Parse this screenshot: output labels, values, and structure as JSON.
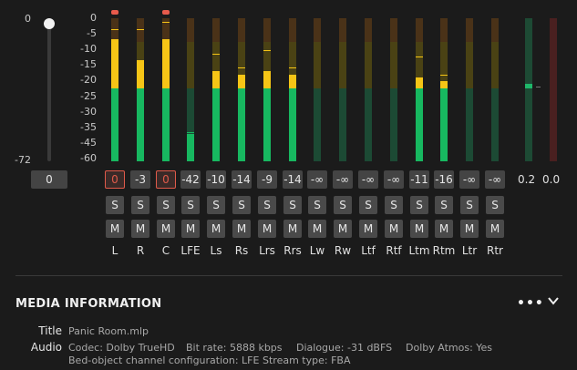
{
  "master_fader": {
    "top_label": "0",
    "bottom_label": "-72",
    "value": "0",
    "level_fraction": 1.0
  },
  "meter_scale": [
    "0",
    "-5",
    "-10",
    "-15",
    "-20",
    "-25",
    "-30",
    "-35",
    "-40",
    "-45",
    "-50",
    "-60"
  ],
  "channels": [
    {
      "name": "L",
      "peak": "0",
      "clip": true,
      "level_db": -6,
      "hold_db": -3,
      "solo": "S",
      "mute": "M"
    },
    {
      "name": "R",
      "peak": "-3",
      "clip": false,
      "level_db": -12,
      "hold_db": -3,
      "solo": "S",
      "mute": "M"
    },
    {
      "name": "C",
      "peak": "0",
      "clip": true,
      "level_db": -6,
      "hold_db": -1,
      "solo": "S",
      "mute": "M"
    },
    {
      "name": "LFE",
      "peak": "-42",
      "clip": false,
      "level_db": -45,
      "hold_db": -44,
      "solo": "S",
      "mute": "M"
    },
    {
      "name": "Ls",
      "peak": "-10",
      "clip": false,
      "level_db": -15,
      "hold_db": -10,
      "solo": "S",
      "mute": "M"
    },
    {
      "name": "Rs",
      "peak": "-14",
      "clip": false,
      "level_db": -16,
      "hold_db": -14,
      "solo": "S",
      "mute": "M"
    },
    {
      "name": "Lrs",
      "peak": "-9",
      "clip": false,
      "level_db": -15,
      "hold_db": -9,
      "solo": "S",
      "mute": "M"
    },
    {
      "name": "Rrs",
      "peak": "-14",
      "clip": false,
      "level_db": -16,
      "hold_db": -14,
      "solo": "S",
      "mute": "M"
    },
    {
      "name": "Lw",
      "peak": "-∞",
      "clip": false,
      "level_db": null,
      "hold_db": null,
      "solo": "S",
      "mute": "M"
    },
    {
      "name": "Rw",
      "peak": "-∞",
      "clip": false,
      "level_db": null,
      "hold_db": null,
      "solo": "S",
      "mute": "M"
    },
    {
      "name": "Ltf",
      "peak": "-∞",
      "clip": false,
      "level_db": null,
      "hold_db": null,
      "solo": "S",
      "mute": "M"
    },
    {
      "name": "Rtf",
      "peak": "-∞",
      "clip": false,
      "level_db": null,
      "hold_db": null,
      "solo": "S",
      "mute": "M"
    },
    {
      "name": "Ltm",
      "peak": "-11",
      "clip": false,
      "level_db": -17,
      "hold_db": -11,
      "solo": "S",
      "mute": "M"
    },
    {
      "name": "Rtm",
      "peak": "-16",
      "clip": false,
      "level_db": -18,
      "hold_db": -16,
      "solo": "S",
      "mute": "M"
    },
    {
      "name": "Ltr",
      "peak": "-∞",
      "clip": false,
      "level_db": null,
      "hold_db": null,
      "solo": "S",
      "mute": "M"
    },
    {
      "name": "Rtr",
      "peak": "-∞",
      "clip": false,
      "level_db": null,
      "hold_db": null,
      "solo": "S",
      "mute": "M"
    }
  ],
  "extra_meters": [
    {
      "value": "0.2",
      "color": "#1fb86a",
      "level_db": -20
    },
    {
      "value": "0.0",
      "color": "#c0392b",
      "level_db": null
    }
  ],
  "colors": {
    "green": "#17b860",
    "green_dim": "#1c4a34",
    "yellow": "#f6c516",
    "yellow_dim": "#4a4214",
    "orange_dim": "#4a3218",
    "clip_red": "#e05a4a"
  },
  "media_info": {
    "section_title": "MEDIA INFORMATION",
    "more_icon": "more-horizontal-icon",
    "collapse_icon": "chevron-down-icon",
    "title_label": "Title",
    "title_value": "Panic Room.mlp",
    "audio_label": "Audio",
    "codec": "Codec: Dolby TrueHD",
    "bitrate": "Bit rate: 5888 kbps",
    "dialogue": "Dialogue: -31 dBFS",
    "atmos": "Dolby Atmos: Yes",
    "bed_config": "Bed-object channel configuration: LFE",
    "stream_type": "Stream type: FBA"
  }
}
